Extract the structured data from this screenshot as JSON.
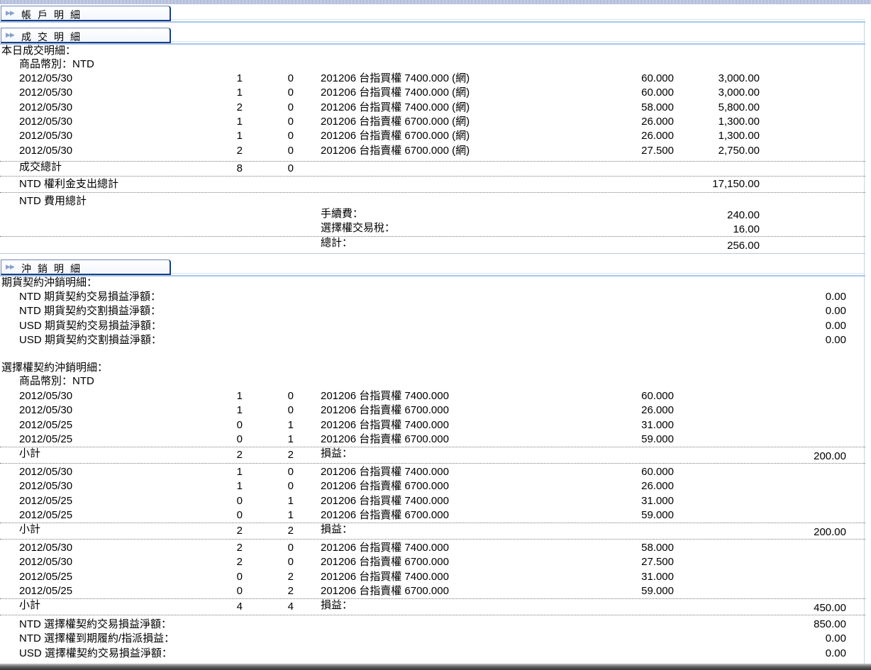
{
  "sections": {
    "account": "帳戶明細",
    "trade": "成交明細",
    "offset": "沖銷明細"
  },
  "trade": {
    "heading": "本日成交明細：",
    "currency_label": "商品幣別：NTD",
    "rows": [
      {
        "date": "2012/05/30",
        "buy": "1",
        "sell": "0",
        "product": "201206 台指買權 7400.000 (網)",
        "price": "60.000",
        "amount": "3,000.00"
      },
      {
        "date": "2012/05/30",
        "buy": "1",
        "sell": "0",
        "product": "201206 台指買權 7400.000 (網)",
        "price": "60.000",
        "amount": "3,000.00"
      },
      {
        "date": "2012/05/30",
        "buy": "2",
        "sell": "0",
        "product": "201206 台指買權 7400.000 (網)",
        "price": "58.000",
        "amount": "5,800.00"
      },
      {
        "date": "2012/05/30",
        "buy": "1",
        "sell": "0",
        "product": "201206 台指賣權 6700.000 (網)",
        "price": "26.000",
        "amount": "1,300.00"
      },
      {
        "date": "2012/05/30",
        "buy": "1",
        "sell": "0",
        "product": "201206 台指賣權 6700.000 (網)",
        "price": "26.000",
        "amount": "1,300.00"
      },
      {
        "date": "2012/05/30",
        "buy": "2",
        "sell": "0",
        "product": "201206 台指賣權 6700.000 (網)",
        "price": "27.500",
        "amount": "2,750.00"
      }
    ],
    "total_label": "成交總計",
    "total_buy": "8",
    "total_sell": "0",
    "premium_label": "NTD 權利金支出總計",
    "premium_value": "17,150.00",
    "fee_label": "NTD 費用總計",
    "commission_label": "手續費：",
    "commission_value": "240.00",
    "tax_label": "選擇權交易稅：",
    "tax_value": "16.00",
    "sum_label": "總計：",
    "sum_value": "256.00"
  },
  "futures": {
    "heading": "期貨契約沖銷明細：",
    "lines": [
      {
        "label": "NTD 期貨契約交易損益淨額：",
        "value": "0.00"
      },
      {
        "label": "NTD 期貨契約交割損益淨額：",
        "value": "0.00"
      },
      {
        "label": "USD 期貨契約交易損益淨額：",
        "value": "0.00"
      },
      {
        "label": "USD 期貨契約交割損益淨額：",
        "value": "0.00"
      }
    ]
  },
  "options": {
    "heading": "選擇權契約沖銷明細：",
    "currency_label": "商品幣別：NTD",
    "groups": [
      {
        "rows": [
          {
            "date": "2012/05/30",
            "buy": "1",
            "sell": "0",
            "product": "201206 台指買權 7400.000",
            "price": "60.000"
          },
          {
            "date": "2012/05/30",
            "buy": "1",
            "sell": "0",
            "product": "201206 台指賣權 6700.000",
            "price": "26.000"
          },
          {
            "date": "2012/05/25",
            "buy": "0",
            "sell": "1",
            "product": "201206 台指買權 7400.000",
            "price": "31.000"
          },
          {
            "date": "2012/05/25",
            "buy": "0",
            "sell": "1",
            "product": "201206 台指賣權 6700.000",
            "price": "59.000"
          }
        ],
        "subtotal_label": "小計",
        "sub_buy": "2",
        "sub_sell": "2",
        "pl_label": "損益：",
        "pl_value": "200.00"
      },
      {
        "rows": [
          {
            "date": "2012/05/30",
            "buy": "1",
            "sell": "0",
            "product": "201206 台指買權 7400.000",
            "price": "60.000"
          },
          {
            "date": "2012/05/30",
            "buy": "1",
            "sell": "0",
            "product": "201206 台指賣權 6700.000",
            "price": "26.000"
          },
          {
            "date": "2012/05/25",
            "buy": "0",
            "sell": "1",
            "product": "201206 台指買權 7400.000",
            "price": "31.000"
          },
          {
            "date": "2012/05/25",
            "buy": "0",
            "sell": "1",
            "product": "201206 台指賣權 6700.000",
            "price": "59.000"
          }
        ],
        "subtotal_label": "小計",
        "sub_buy": "2",
        "sub_sell": "2",
        "pl_label": "損益：",
        "pl_value": "200.00"
      },
      {
        "rows": [
          {
            "date": "2012/05/30",
            "buy": "2",
            "sell": "0",
            "product": "201206 台指買權 7400.000",
            "price": "58.000"
          },
          {
            "date": "2012/05/30",
            "buy": "2",
            "sell": "0",
            "product": "201206 台指賣權 6700.000",
            "price": "27.500"
          },
          {
            "date": "2012/05/25",
            "buy": "0",
            "sell": "2",
            "product": "201206 台指買權 7400.000",
            "price": "31.000"
          },
          {
            "date": "2012/05/25",
            "buy": "0",
            "sell": "2",
            "product": "201206 台指賣權 6700.000",
            "price": "59.000"
          }
        ],
        "subtotal_label": "小計",
        "sub_buy": "4",
        "sub_sell": "4",
        "pl_label": "損益：",
        "pl_value": "450.00"
      }
    ],
    "summary": [
      {
        "label": "NTD 選擇權契約交易損益淨額：",
        "value": "850.00"
      },
      {
        "label": "NTD 選擇權到期履約/指派損益：",
        "value": "0.00"
      },
      {
        "label": "USD 選擇權契約交易損益淨額：",
        "value": "0.00"
      }
    ]
  }
}
